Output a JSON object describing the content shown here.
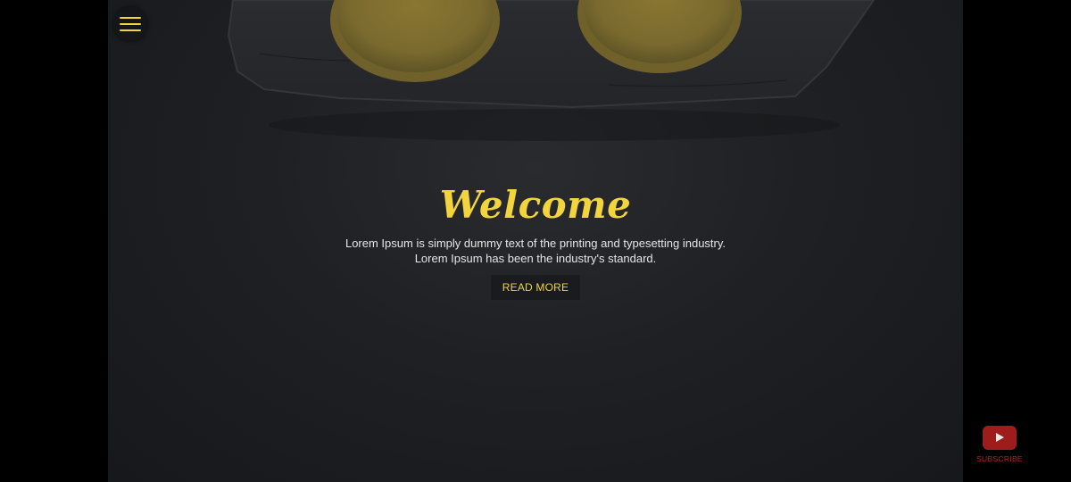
{
  "menu": {
    "icon": "hamburger-menu-icon",
    "accent_color": "#f2d43d"
  },
  "hero": {
    "title": "Welcome",
    "line1": "Lorem Ipsum is simply dummy text of the printing and typesetting industry.",
    "line2": "Lorem Ipsum has been the industry's standard.",
    "button_label": "READ MORE",
    "background_image": "slate board with lemon halves"
  },
  "subscribe": {
    "icon": "youtube-icon",
    "label": "SUBSCRIBE",
    "color": "#b52424"
  }
}
